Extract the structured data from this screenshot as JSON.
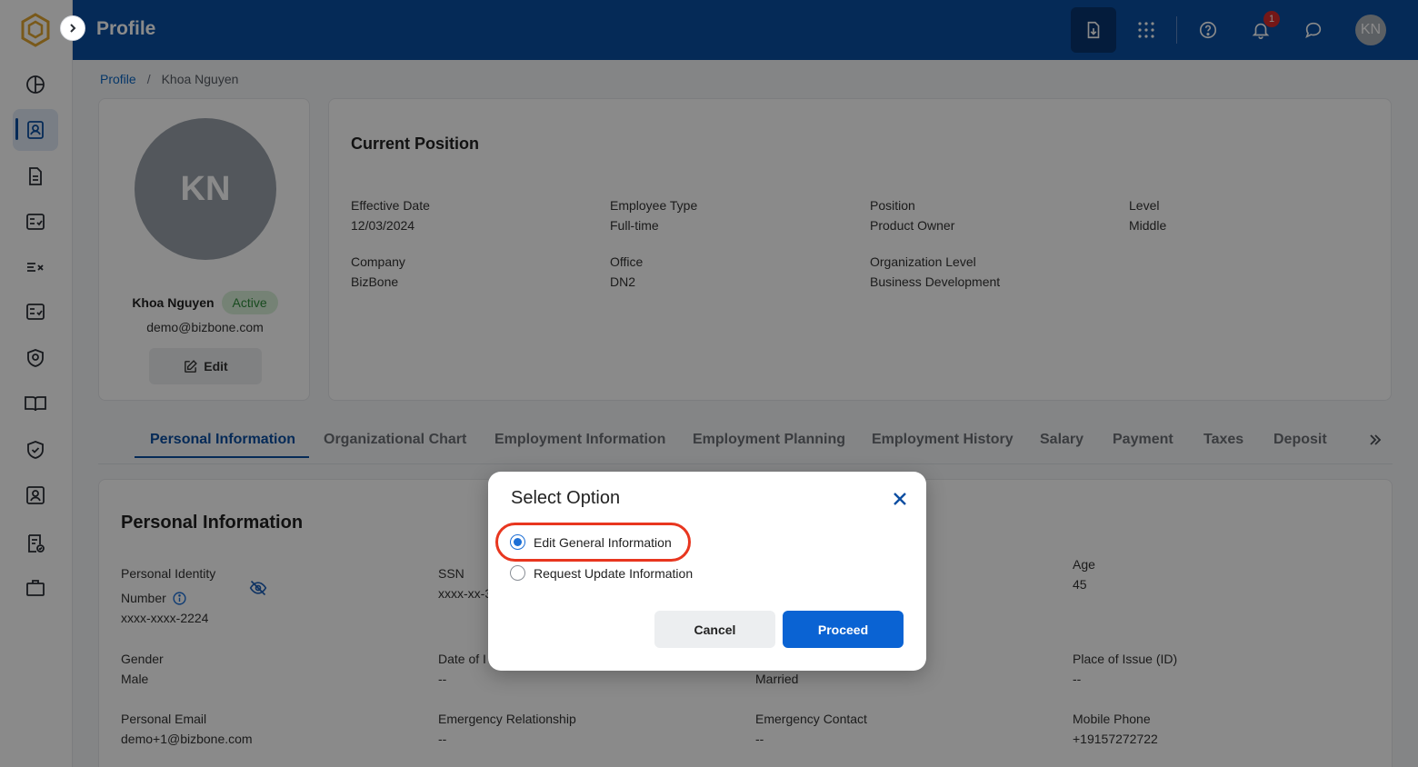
{
  "header": {
    "title": "Profile",
    "notification_count": "1",
    "user_initials": "KN"
  },
  "breadcrumb": {
    "root": "Profile",
    "separator": "/",
    "current": "Khoa Nguyen"
  },
  "profile": {
    "initials": "KN",
    "name": "Khoa Nguyen",
    "status": "Active",
    "email": "demo@bizbone.com",
    "edit_label": "Edit"
  },
  "position": {
    "title": "Current Position",
    "fields": [
      {
        "label": "Effective Date",
        "value": "12/03/2024"
      },
      {
        "label": "Employee Type",
        "value": "Full-time"
      },
      {
        "label": "Position",
        "value": "Product Owner"
      },
      {
        "label": "Level",
        "value": "Middle"
      },
      {
        "label": "Company",
        "value": "BizBone"
      },
      {
        "label": "Office",
        "value": "DN2"
      },
      {
        "label": "Organization Level",
        "value": "Business Development"
      }
    ]
  },
  "tabs": [
    {
      "label": "Personal Information",
      "active": true
    },
    {
      "label": "Organizational Chart"
    },
    {
      "label": "Employment Information"
    },
    {
      "label": "Employment Planning"
    },
    {
      "label": "Employment History"
    },
    {
      "label": "Salary"
    },
    {
      "label": "Payment"
    },
    {
      "label": "Taxes"
    },
    {
      "label": "Deposit"
    }
  ],
  "personal": {
    "title": "Personal Information",
    "fields": [
      {
        "label": "Personal Identity",
        "label2": "Number",
        "value": "xxxx-xxxx-2224"
      },
      {
        "label": "SSN",
        "value": "xxxx-xx-3"
      },
      {
        "label": "Age",
        "value": "45"
      },
      {
        "label": "Gender",
        "value": "Male"
      },
      {
        "label": "Date of I",
        "value": "--"
      },
      {
        "label": "",
        "value": "Married"
      },
      {
        "label": "Place of Issue (ID)",
        "value": "--"
      },
      {
        "label": "Personal Email",
        "value": "demo+1@bizbone.com"
      },
      {
        "label": "Emergency Relationship",
        "value": "--"
      },
      {
        "label": "Emergency Contact",
        "value": "--"
      },
      {
        "label": "Mobile Phone",
        "value": "+19157272722"
      }
    ]
  },
  "modal": {
    "title": "Select Option",
    "options": [
      {
        "label": "Edit General Information",
        "checked": true
      },
      {
        "label": "Request Update Information",
        "checked": false
      }
    ],
    "cancel_label": "Cancel",
    "proceed_label": "Proceed"
  },
  "colors": {
    "primary": "#0b4ea2",
    "accent_button": "#0a63d3",
    "highlight_ring": "#e8361f",
    "status_green": "#2e8b3a",
    "notification_red": "#d62b2b"
  }
}
